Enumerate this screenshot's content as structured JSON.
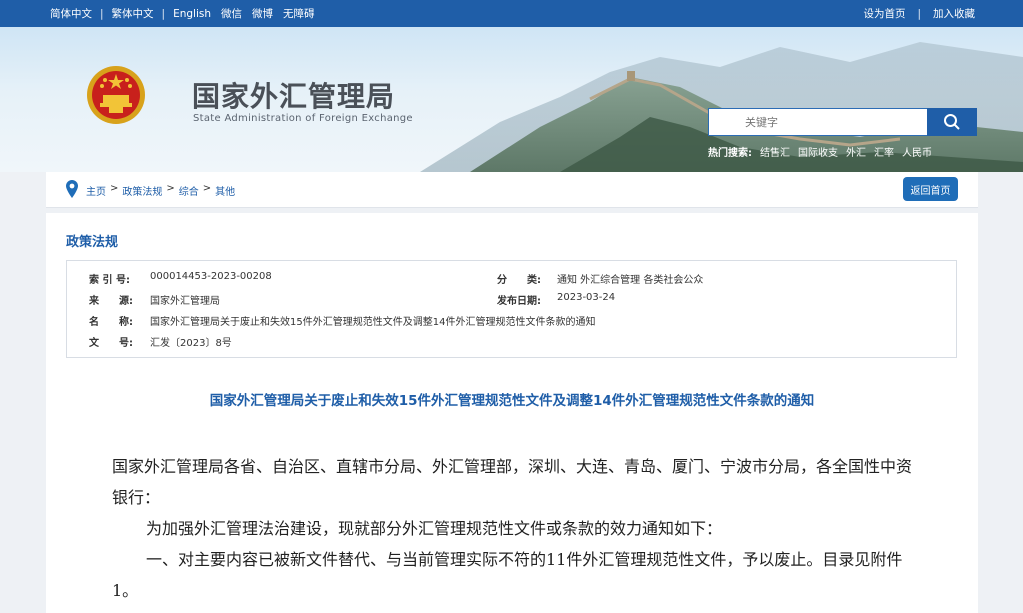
{
  "topbar": {
    "lang_simplified": "简体中文",
    "lang_traditional": "繁体中文",
    "lang_english": "English",
    "weixin": "微信",
    "weibo": "微博",
    "accessibility": "无障碍",
    "set_homepage": "设为首页",
    "add_favorite": "加入收藏",
    "separator": "|"
  },
  "header": {
    "title": "国家外汇管理局",
    "subtitle": "State Administration of Foreign Exchange",
    "search_placeholder": "关键字",
    "hot_label": "热门搜索:",
    "hot_keywords": [
      "结售汇",
      "国际收支",
      "外汇",
      "汇率",
      "人民币"
    ]
  },
  "breadcrumb": {
    "items": [
      "主页",
      "政策法规",
      "综合",
      "其他"
    ],
    "separator": ">",
    "back_button": "返回首页"
  },
  "section_title": "政策法规",
  "meta": {
    "index_label": "索 引 号:",
    "index_value": "000014453-2023-00208",
    "category_label": "分　　类:",
    "category_value": "通知 外汇综合管理 各类社会公众",
    "source_label": "来　　源:",
    "source_value": "国家外汇管理局",
    "date_label": "发布日期:",
    "date_value": "2023-03-24",
    "name_label": "名　　称:",
    "name_value": "国家外汇管理局关于废止和失效15件外汇管理规范性文件及调整14件外汇管理规范性文件条款的通知",
    "docno_label": "文　　号:",
    "docno_value": "汇发〔2023〕8号"
  },
  "document": {
    "title": "国家外汇管理局关于废止和失效15件外汇管理规范性文件及调整14件外汇管理规范性文件条款的通知",
    "para1": "国家外汇管理局各省、自治区、直辖市分局、外汇管理部，深圳、大连、青岛、厦门、宁波市分局，各全国性中资银行：",
    "para2": "为加强外汇管理法治建设，现就部分外汇管理规范性文件或条款的效力通知如下：",
    "para3": "一、对主要内容已被新文件替代、与当前管理实际不符的11件外汇管理规范性文件，予以废止。目录见附件1。"
  },
  "colors": {
    "brand_blue": "#1f5ea8",
    "title_gray": "#4a5058"
  }
}
